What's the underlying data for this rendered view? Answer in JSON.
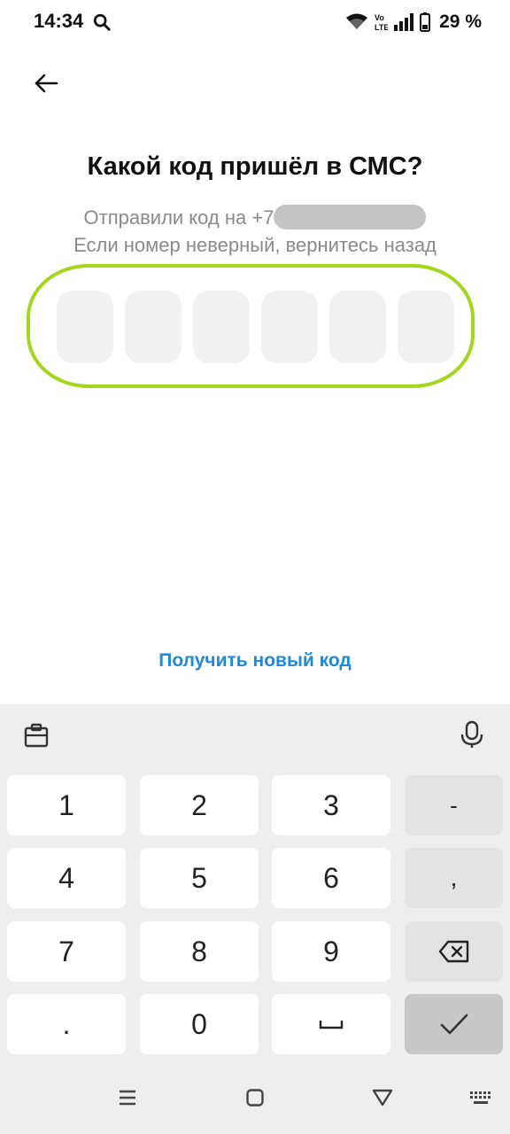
{
  "status_bar": {
    "time": "14:34",
    "battery_percent": "29 %",
    "icons": [
      "search-icon",
      "wifi-icon",
      "volte-icon",
      "signal-icon",
      "battery-icon"
    ]
  },
  "header": {
    "back_icon": "arrow-left-icon"
  },
  "main": {
    "title": "Какой код пришёл в СМС?",
    "sent_to_prefix": "Отправили код на +7",
    "wrong_number_hint": "Если номер неверный, вернитесь назад",
    "code_length": 6,
    "resend_label": "Получить новый код",
    "highlight_color": "#a5d619",
    "link_color": "#1e88e5"
  },
  "keyboard": {
    "toolbar_left_icon": "clipboard-icon",
    "toolbar_right_icon": "microphone-icon",
    "keys": {
      "k1": "1",
      "k2": "2",
      "k3": "3",
      "dash": "-",
      "k4": "4",
      "k5": "5",
      "k6": "6",
      "comma": ",",
      "k7": "7",
      "k8": "8",
      "k9": "9",
      "backspace_icon": "backspace-icon",
      "dot": ".",
      "k0": "0",
      "space_icon": "space-icon",
      "enter_icon": "checkmark-icon"
    }
  },
  "nav_bar": {
    "icons": [
      "menu-icon",
      "home-icon",
      "back-triangle-icon",
      "keyboard-icon"
    ]
  }
}
